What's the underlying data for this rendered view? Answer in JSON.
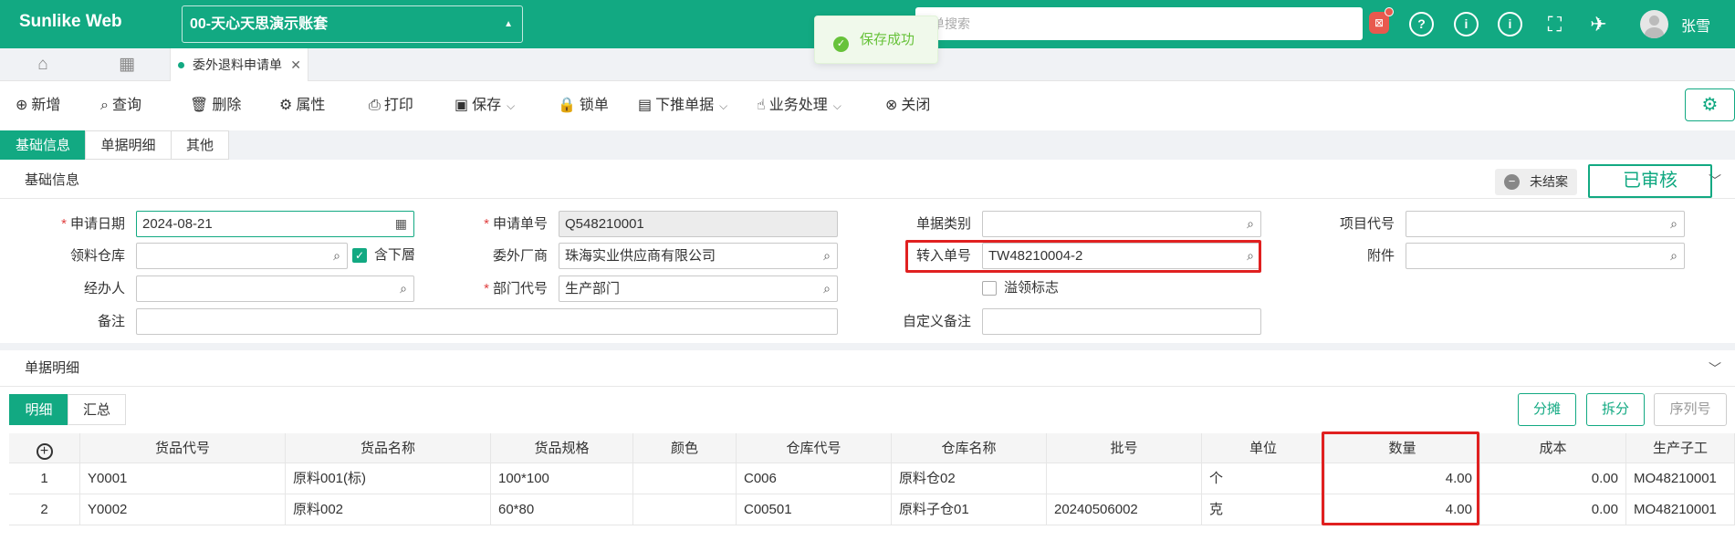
{
  "header": {
    "brand": "Sunlike Web",
    "account": "00-天心天思演示账套",
    "search_placeholder": "单搜索",
    "bell_label": "⊠",
    "user": "张雪"
  },
  "toast": {
    "message": "保存成功"
  },
  "tabbar": {
    "doc_tab": "委外退料申请单"
  },
  "toolbar": {
    "add": "新增",
    "query": "查询",
    "delete": "删除",
    "properties": "属性",
    "print": "打印",
    "save": "保存",
    "lock": "锁单",
    "push_down": "下推单据",
    "business": "业务处理",
    "close": "关闭"
  },
  "form_tabs": [
    "基础信息",
    "单据明细",
    "其他"
  ],
  "section_basic": {
    "title": "基础信息",
    "status": "未结案",
    "approval": "已审核"
  },
  "fields": {
    "apply_date_label": "申请日期",
    "apply_date": "2024-08-21",
    "apply_no_label": "申请单号",
    "apply_no": "Q548210001",
    "doc_type_label": "单据类别",
    "doc_type": "",
    "project_code_label": "项目代号",
    "project_code": "",
    "warehouse_label": "领料仓库",
    "warehouse": "",
    "include_lower_label": "含下層",
    "include_lower_checked": true,
    "vendor_label": "委外厂商",
    "vendor": "珠海实业供应商有限公司",
    "transfer_no_label": "转入单号",
    "transfer_no": "TW48210004-2",
    "attachment_label": "附件",
    "attachment": "",
    "handler_label": "经办人",
    "handler": "",
    "dept_label": "部门代号",
    "dept": "生产部门",
    "over_pick_label": "溢领标志",
    "over_pick_checked": false,
    "remark_label": "备注",
    "remark": "",
    "custom_remark_label": "自定义备注",
    "custom_remark": ""
  },
  "section_detail": {
    "title": "单据明细"
  },
  "detail_tabs": [
    "明细",
    "汇总"
  ],
  "detail_buttons": {
    "allocate": "分摊",
    "split": "拆分",
    "serial": "序列号"
  },
  "table": {
    "columns": [
      "货品代号",
      "货品名称",
      "货品规格",
      "颜色",
      "仓库代号",
      "仓库名称",
      "批号",
      "单位",
      "数量",
      "成本",
      "生产子工"
    ],
    "rows": [
      {
        "seq": "1",
        "cells": [
          "Y0001",
          "原料001(标)",
          "100*100",
          "",
          "C006",
          "原料仓02",
          "",
          "个",
          "4.00",
          "0.00",
          "MO48210001"
        ]
      },
      {
        "seq": "2",
        "cells": [
          "Y0002",
          "原料002",
          "60*80",
          "",
          "C00501",
          "原料子仓01",
          "20240506002",
          "克",
          "4.00",
          "0.00",
          "MO48210001"
        ]
      }
    ]
  }
}
